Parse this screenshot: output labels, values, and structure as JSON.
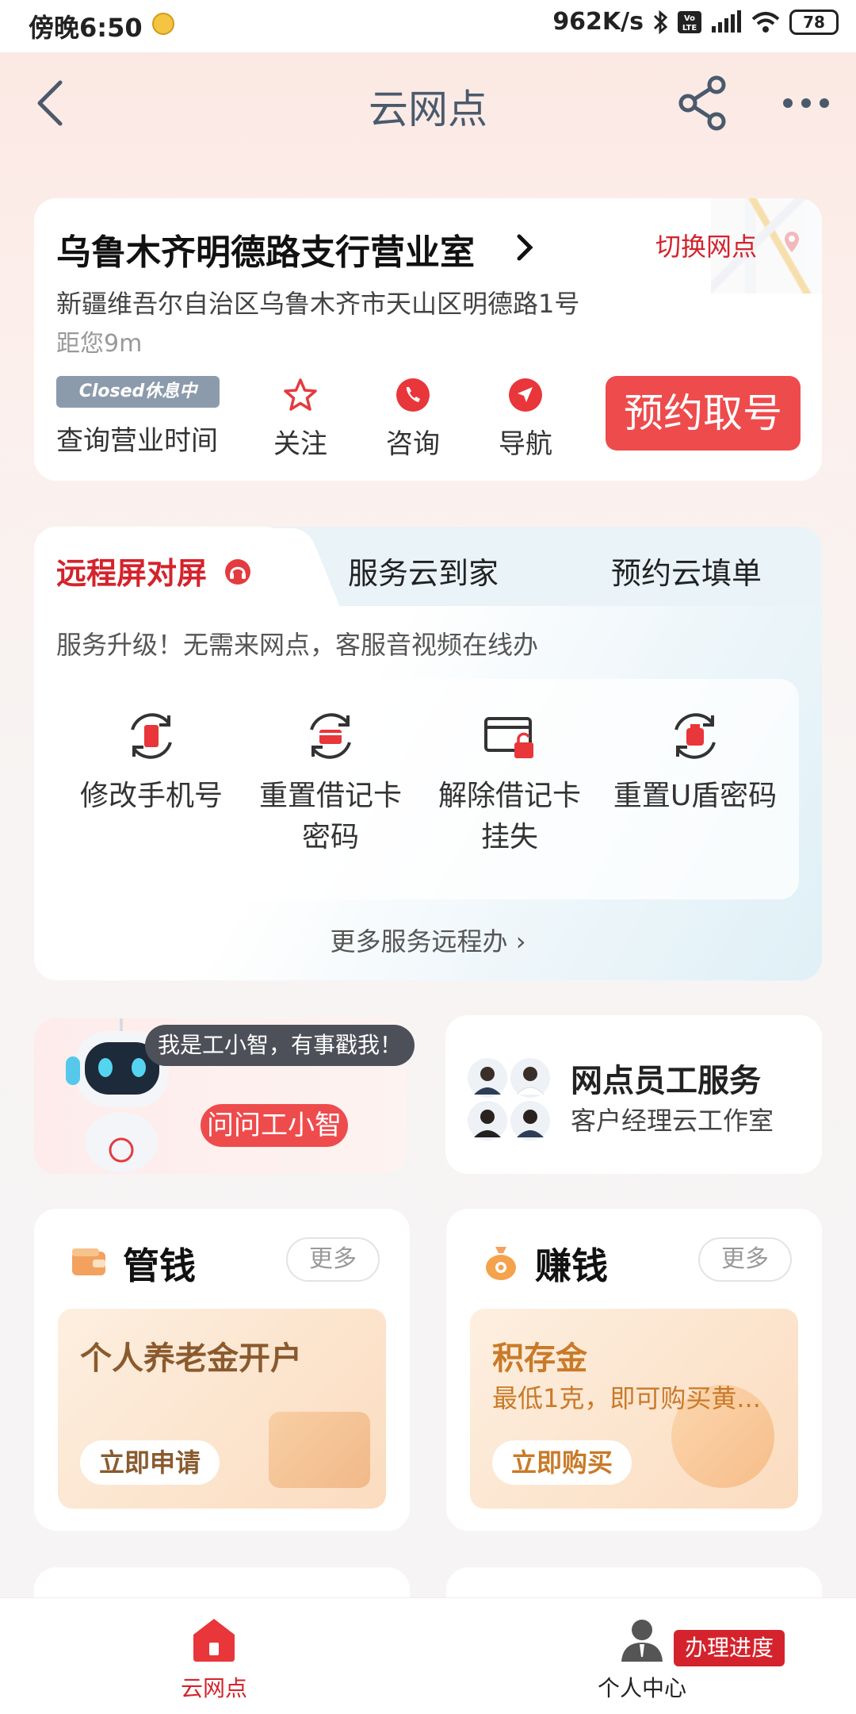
{
  "status_bar": {
    "time": "傍晚6:50",
    "network_speed": "962K/s",
    "battery": "78"
  },
  "header": {
    "title": "云网点"
  },
  "branch": {
    "name": "乌鲁木齐明德路支行营业室",
    "switch_label": "切换网点",
    "address": "新疆维吾尔自治区乌鲁木齐市天山区明德路1号",
    "distance": "距您9m",
    "closed_badge": "Closed休息中",
    "hours_link": "查询营业时间",
    "actions": [
      {
        "label": "关注",
        "icon": "star-icon"
      },
      {
        "label": "咨询",
        "icon": "phone-icon"
      },
      {
        "label": "导航",
        "icon": "navigate-icon"
      }
    ],
    "book_button": "预约取号"
  },
  "services": {
    "tabs": [
      {
        "label": "远程屏对屏",
        "active": true
      },
      {
        "label": "服务云到家",
        "active": false
      },
      {
        "label": "预约云填单",
        "active": false
      }
    ],
    "description": "服务升级！无需来网点，客服音视频在线办",
    "items": [
      {
        "label": "修改手机号",
        "icon": "phone-refresh-icon"
      },
      {
        "label": "重置借记卡密码",
        "icon": "card-refresh-icon"
      },
      {
        "label": "解除借记卡挂失",
        "icon": "card-unlock-icon"
      },
      {
        "label": "重置U盾密码",
        "icon": "ukey-refresh-icon"
      }
    ],
    "more_link": "更多服务远程办"
  },
  "assistant": {
    "bubble": "我是工小智，有事戳我！",
    "button": "问问工小智"
  },
  "staff": {
    "title": "网点员工服务",
    "subtitle": "客户经理云工作室"
  },
  "products": [
    {
      "title": "管钱",
      "icon": "wallet-icon",
      "more": "更多",
      "promo_title": "个人养老金开户",
      "promo_sub": "",
      "promo_button": "立即申请"
    },
    {
      "title": "赚钱",
      "icon": "money-bag-icon",
      "more": "更多",
      "promo_title": "积存金",
      "promo_sub": "最低1克，即可购买黄...",
      "promo_button": "立即购买"
    }
  ],
  "bottom_nav": {
    "items": [
      {
        "label": "云网点",
        "active": true
      },
      {
        "label": "个人中心",
        "active": false
      }
    ],
    "progress_badge": "办理进度"
  },
  "colors": {
    "accent_red": "#d4232c",
    "button_red": "#ee4b4d",
    "header_gray": "#4a5a6c"
  }
}
